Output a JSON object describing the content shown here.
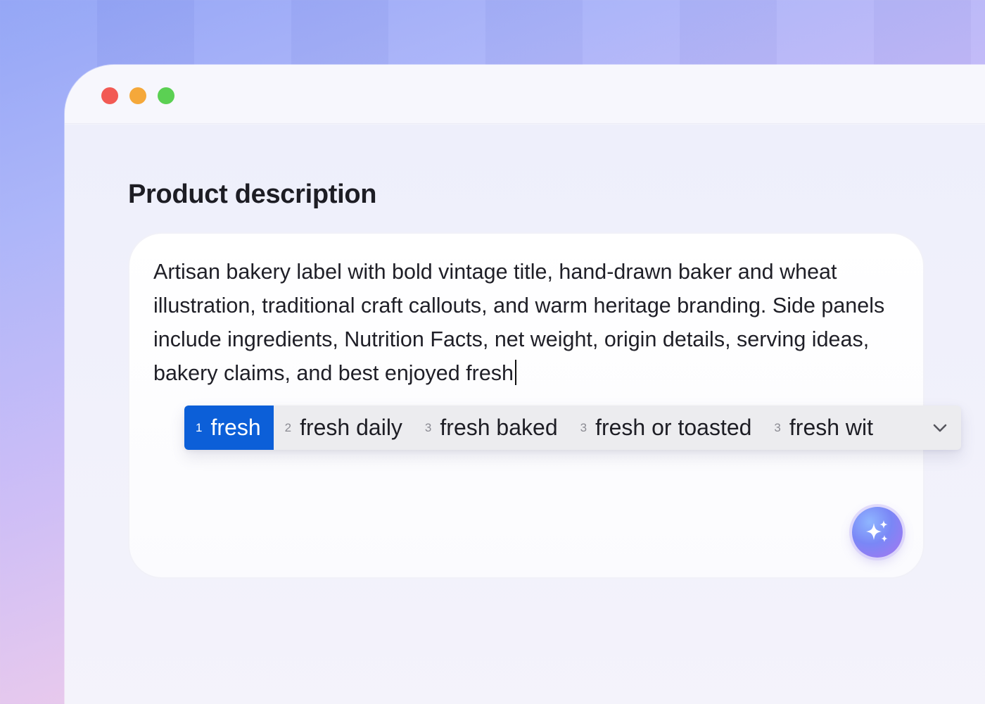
{
  "window": {
    "controls": [
      "close",
      "minimize",
      "zoom"
    ],
    "colors": {
      "close": "#f25a54",
      "minimize": "#f5a83a",
      "zoom": "#5bd053"
    }
  },
  "form": {
    "heading": "Product description",
    "text": "Artisan bakery label with bold vintage title, hand-drawn baker and wheat illustration, traditional craft callouts, and warm heritage branding. Side panels include ingredients, Nutrition Facts, net weight, origin details, serving ideas, bakery claims, and best enjoyed fresh"
  },
  "suggestions": {
    "items": [
      {
        "num": "1",
        "text": "fresh",
        "selected": true
      },
      {
        "num": "2",
        "text": "fresh daily",
        "selected": false
      },
      {
        "num": "3",
        "text": "fresh baked",
        "selected": false
      },
      {
        "num": "3",
        "text": "fresh or toasted",
        "selected": false
      },
      {
        "num": "3",
        "text": "fresh wit",
        "selected": false
      }
    ],
    "expand_icon": "chevron-down-icon",
    "accent": "#0c5fd8"
  },
  "ai_button": {
    "icon": "sparkles-icon"
  }
}
